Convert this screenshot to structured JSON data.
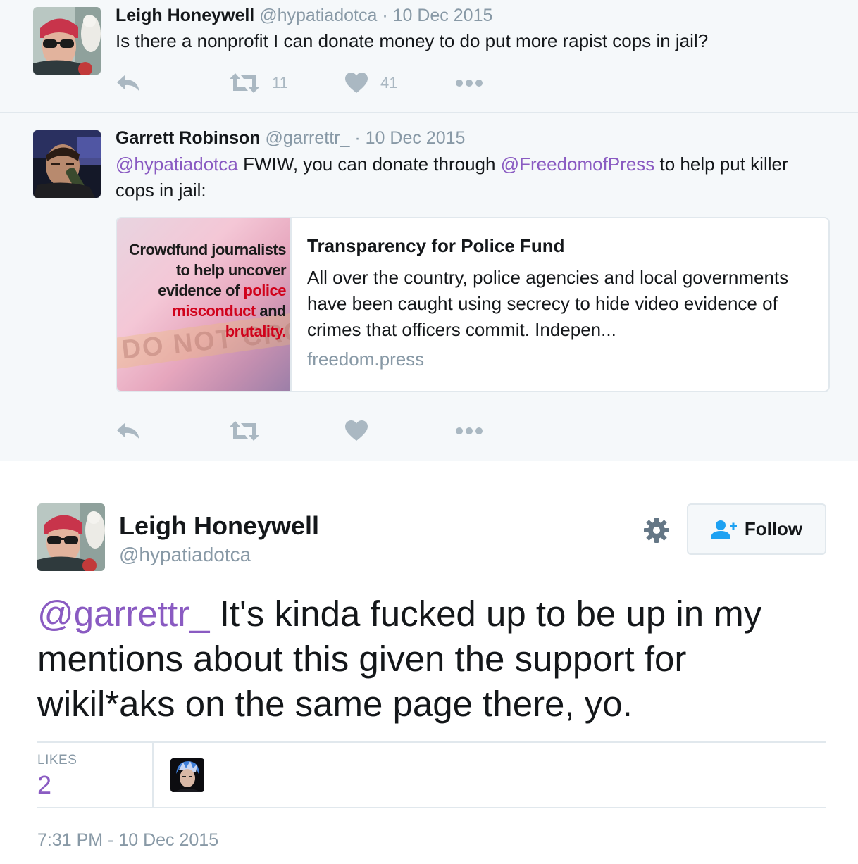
{
  "tweet1": {
    "name": "Leigh Honeywell",
    "handle": "@hypatiadotca",
    "date": "· 10 Dec 2015",
    "text": "Is there a nonprofit I can donate money to do put more rapist cops in jail?",
    "retweets": "11",
    "likes": "41",
    "icons": {
      "reply": "reply-icon",
      "retweet": "retweet-icon",
      "like": "heart-icon",
      "more": "more-icon"
    }
  },
  "tweet2": {
    "name": "Garrett Robinson",
    "handle": "@garrettr_",
    "date": "· 10 Dec 2015",
    "mention1": "@hypatiadotca",
    "text_mid": " FWIW, you can donate through ",
    "mention2": "@FreedomofPress",
    "text_end": " to help put killer cops in jail:",
    "card": {
      "image_lines": [
        "Crowdfund journalists",
        "to help uncover",
        "evidence of",
        "police",
        "misconduct",
        "and",
        "brutality."
      ],
      "image_tape": "DO NOT CROSS",
      "title": "Transparency for Police Fund",
      "description": "All over the country, police agencies and local governments have been caught using secrecy to hide video evidence of crimes that officers commit. Indepen...",
      "domain": "freedom.press"
    }
  },
  "main": {
    "name": "Leigh Honeywell",
    "handle": "@hypatiadotca",
    "follow_label": "Follow",
    "mention": "@garrettr_",
    "text": " It's kinda fucked up to be up in my mentions about this given the support for wikil*aks on the same page there, yo.",
    "likes_label": "LIKES",
    "likes_count": "2",
    "timestamp": "7:31 PM - 10 Dec 2015"
  },
  "colors": {
    "link": "#8a5bc2",
    "muted": "#8899a6",
    "icon": "#aab8c2",
    "context_bg": "#f5f8fa",
    "border": "#e1e8ed"
  }
}
